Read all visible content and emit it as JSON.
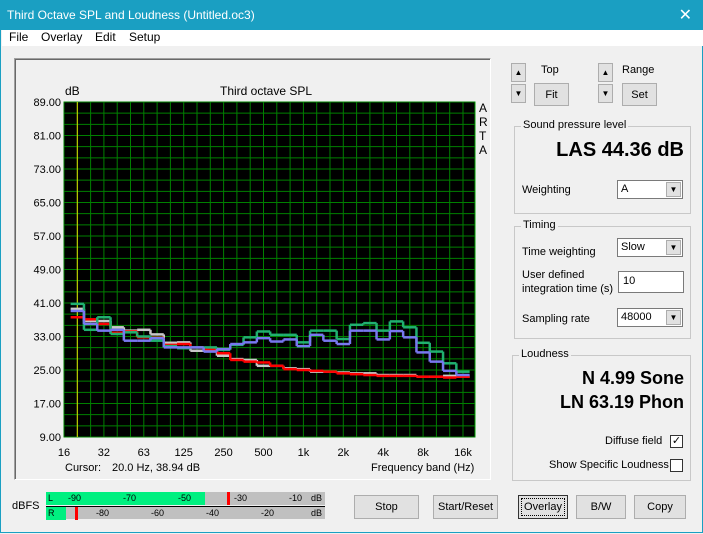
{
  "window": {
    "title": "Third Octave SPL and Loudness (Untitled.oc3)",
    "close": "✕"
  },
  "menu": [
    "File",
    "Overlay",
    "Edit",
    "Setup"
  ],
  "chart_panel": {
    "ylabel": "dB",
    "title": "Third octave SPL",
    "watermark": "ARTA",
    "xlabel": "Frequency band (Hz)",
    "cursor_label": "Cursor:",
    "cursor_value": "20.0 Hz, 38.94 dB"
  },
  "chart_data": {
    "type": "line",
    "title": "Third octave SPL",
    "xlabel": "Frequency band (Hz)",
    "ylabel": "dB",
    "ylim": [
      9,
      89
    ],
    "grid": true,
    "yticks": [
      "89.00",
      "81.00",
      "73.00",
      "65.00",
      "57.00",
      "49.00",
      "41.00",
      "33.00",
      "25.00",
      "17.00",
      "9.00"
    ],
    "xticks": [
      "16",
      "32",
      "63",
      "125",
      "250",
      "500",
      "1k",
      "2k",
      "4k",
      "8k",
      "16k"
    ],
    "x": [
      "20",
      "25",
      "31.5",
      "40",
      "50",
      "63",
      "80",
      "100",
      "125",
      "160",
      "200",
      "250",
      "315",
      "400",
      "500",
      "630",
      "800",
      "1k",
      "1.25k",
      "1.6k",
      "2k",
      "2.5k",
      "3.15k",
      "4k",
      "5k",
      "6.3k",
      "8k",
      "10k",
      "12.5k",
      "16k"
    ],
    "cursor_x": "20",
    "series": [
      {
        "color": "#c8c8c8",
        "values": [
          39.6,
          36.7,
          36.7,
          35.2,
          34.4,
          34.6,
          33.5,
          31.5,
          31.6,
          29.6,
          29.6,
          28.4,
          27.6,
          27.4,
          26,
          26,
          25.4,
          25.2,
          24.6,
          24.6,
          24.4,
          24.2,
          24.2,
          23.8,
          23.8,
          23.8,
          23.4,
          23.4,
          23.6,
          23.4
        ]
      },
      {
        "color": "#ff0000",
        "values": [
          37.6,
          37.1,
          36,
          33.9,
          34.2,
          32.8,
          32.7,
          31,
          31.2,
          30.4,
          30,
          29,
          27.4,
          27,
          26.8,
          26,
          25.2,
          25,
          24.8,
          24.6,
          24.2,
          24,
          23.8,
          23.6,
          23.6,
          23.6,
          23.4,
          23.4,
          23.2,
          23.4
        ]
      },
      {
        "color": "#20b070",
        "values": [
          40.8,
          34.6,
          37.6,
          33.6,
          34,
          33,
          32,
          30.7,
          30.2,
          30.4,
          30.4,
          29.8,
          31,
          32.8,
          34.2,
          33.4,
          33.4,
          31.6,
          34.4,
          34.4,
          32.4,
          35.8,
          36.2,
          34.4,
          36.6,
          35.2,
          31.5,
          29.4,
          26.6,
          24.6
        ]
      },
      {
        "color": "#7878f0",
        "values": [
          39.1,
          36,
          34.4,
          34.6,
          32,
          32,
          32.6,
          30.4,
          30.4,
          30.4,
          29.4,
          30,
          31.2,
          31.6,
          32.6,
          31.8,
          32.3,
          30.7,
          33.4,
          32,
          31.2,
          34.4,
          34.4,
          32.3,
          34.3,
          32.8,
          29.2,
          27,
          24.8,
          23.8
        ]
      }
    ]
  },
  "range_controls": {
    "top_label": "Top",
    "fit": "Fit",
    "range_label": "Range",
    "set": "Set",
    "up": "▲",
    "down": "▼"
  },
  "spl": {
    "legend": "Sound pressure level",
    "value": "LAS 44.36 dB",
    "weighting_label": "Weighting",
    "weighting": "A"
  },
  "timing": {
    "legend": "Timing",
    "time_weighting_label": "Time weighting",
    "time_weighting": "Slow",
    "integration_label_1": "User defined",
    "integration_label_2": "integration time (s)",
    "integration_time": "10",
    "sampling_label": "Sampling rate",
    "sampling_rate": "48000"
  },
  "loudness": {
    "legend": "Loudness",
    "n": "N 4.99 Sone",
    "ln": "LN 63.19 Phon",
    "diffuse_label": "Diffuse field",
    "diffuse_checked": true,
    "specific_label": "Show Specific Loudness",
    "specific_checked": false,
    "check": "✓"
  },
  "meter": {
    "label": "dBFS",
    "left": {
      "ch": "L",
      "ticks": [
        "-90",
        "-70",
        "-50",
        "-30",
        "-10"
      ],
      "unit": "dB",
      "level_fraction": 0.57,
      "peak_fraction": 0.65
    },
    "right": {
      "ch": "R",
      "ticks": [
        "-80",
        "-60",
        "-40",
        "-20"
      ],
      "unit": "dB",
      "level_fraction": 0.07,
      "peak_fraction": 0.105
    }
  },
  "buttons": {
    "stop": "Stop",
    "start_reset": "Start/Reset",
    "overlay": "Overlay",
    "bw": "B/W",
    "copy": "Copy"
  }
}
